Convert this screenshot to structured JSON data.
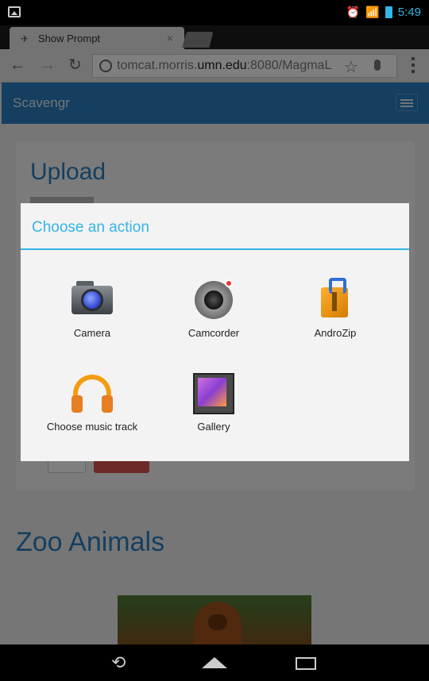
{
  "status_bar": {
    "time": "5:49"
  },
  "browser": {
    "tab_title": "Show Prompt",
    "url_prefix": "tomcat.morris.",
    "url_domain": "umn.edu",
    "url_suffix": ":8080/MagmaL"
  },
  "page": {
    "brand": "Scavengr",
    "upload_title": "Upload",
    "zoo_title": "Zoo Animals"
  },
  "dialog": {
    "title": "Choose an action",
    "options": [
      {
        "label": "Camera",
        "icon": "camera-icon"
      },
      {
        "label": "Camcorder",
        "icon": "camcorder-icon"
      },
      {
        "label": "AndroZip",
        "icon": "androzip-icon"
      },
      {
        "label": "Choose music track",
        "icon": "headphones-icon"
      },
      {
        "label": "Gallery",
        "icon": "gallery-icon"
      }
    ]
  },
  "colors": {
    "accent": "#33b5e5",
    "navbar": "#2b7fc0"
  }
}
